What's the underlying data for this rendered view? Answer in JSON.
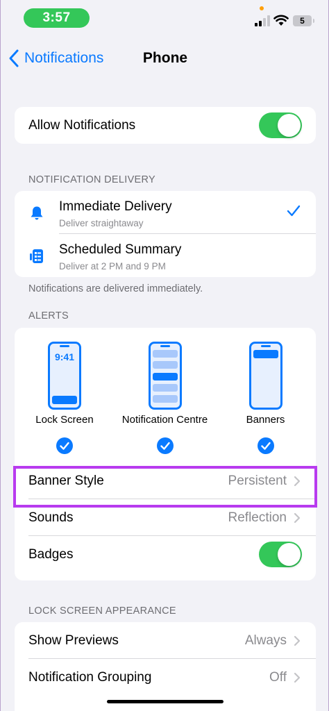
{
  "status": {
    "time": "3:57",
    "battery": "5"
  },
  "nav": {
    "back_label": "Notifications",
    "title": "Phone"
  },
  "allow": {
    "label": "Allow Notifications",
    "enabled": true
  },
  "delivery": {
    "header": "NOTIFICATION DELIVERY",
    "options": [
      {
        "title": "Immediate Delivery",
        "subtitle": "Deliver straightaway",
        "icon": "bell-icon",
        "selected": true
      },
      {
        "title": "Scheduled Summary",
        "subtitle": "Deliver at 2 PM and 9 PM",
        "icon": "summary-icon",
        "selected": false
      }
    ],
    "footer": "Notifications are delivered immediately."
  },
  "alerts": {
    "header": "ALERTS",
    "styles": [
      {
        "label": "Lock Screen",
        "preview_time": "9:41",
        "checked": true
      },
      {
        "label": "Notification Centre",
        "checked": true
      },
      {
        "label": "Banners",
        "checked": true
      }
    ],
    "banner_style": {
      "label": "Banner Style",
      "value": "Persistent"
    },
    "sounds": {
      "label": "Sounds",
      "value": "Reflection"
    },
    "badges": {
      "label": "Badges",
      "enabled": true
    }
  },
  "lock_screen": {
    "header": "LOCK SCREEN APPEARANCE",
    "show_previews": {
      "label": "Show Previews",
      "value": "Always"
    },
    "grouping": {
      "label": "Notification Grouping",
      "value": "Off"
    }
  },
  "colors": {
    "accent": "#0a7aff",
    "toggle_on": "#34c759",
    "highlight": "#b83bef",
    "background": "#f2f2f7"
  }
}
